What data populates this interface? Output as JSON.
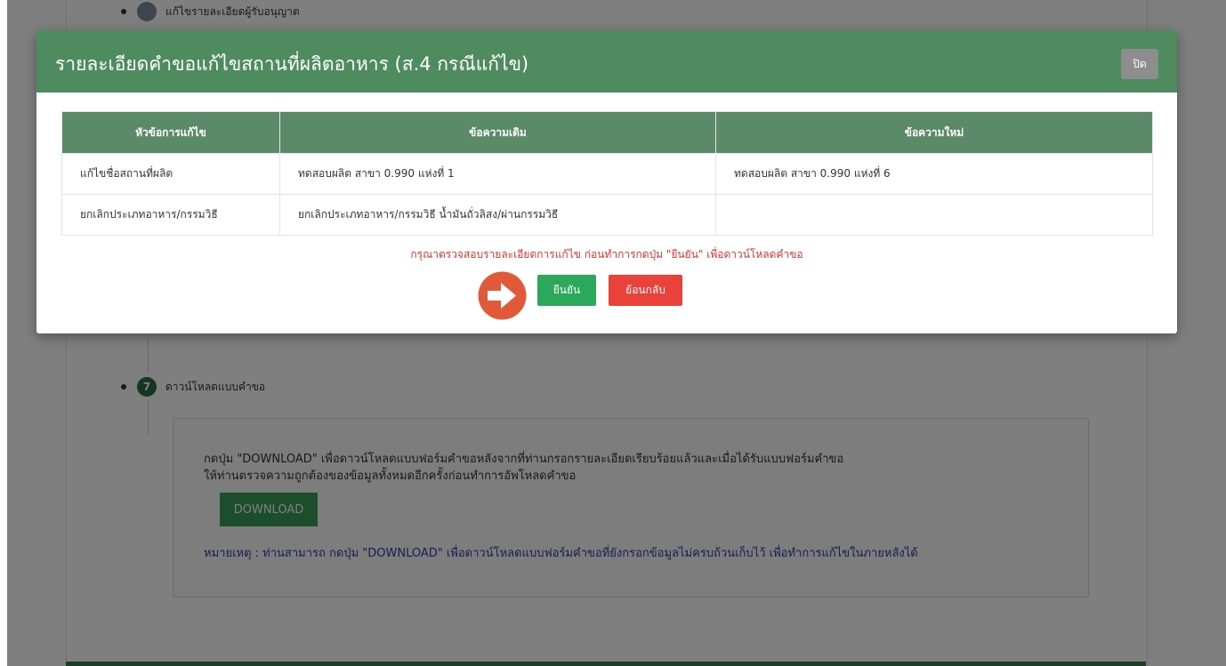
{
  "background": {
    "step_top": {
      "label": "แก้ไขรายละเอียดผู้รับอนุญาต"
    },
    "step_seven": {
      "number": "7",
      "label": "ดาวน์โหลดแบบคำขอ"
    },
    "download_section": {
      "instruction_line1": "กดปุ่ม \"DOWNLOAD\" เพื่อดาวน์โหลดแบบฟอร์มคำขอหลังจากที่ท่านกรอกรายละเอียดเรียบร้อยแล้วและเมื่อได้รับแบบฟอร์มคำขอ",
      "instruction_line2": "ให้ท่านตรวจความถูกต้องของข้อมูลทั้งหมดอีกครั้งก่อนทำการอัพโหลดคำขอ",
      "download_button": "DOWNLOAD",
      "note": "หมายเหตุ : ท่านสามารถ กดปุ่ม \"DOWNLOAD\" เพื่อดาวน์โหลดแบบฟอร์มคำขอที่ยังกรอกข้อมูลไม่ครบถ้วนเก็บไว้ เพื่อทำการแก้ไขในภายหลังได้"
    }
  },
  "modal": {
    "title": "รายละเอียดคำขอแก้ไขสถานที่ผลิตอาหาร (ส.4 กรณีแก้ไข)",
    "close_label": "ปิด",
    "table": {
      "headers": [
        "หัวข้อการแก้ไข",
        "ข้อความเดิม",
        "ข้อความใหม่"
      ],
      "rows": [
        [
          "แก้ไขชื่อสถานที่ผลิต",
          "ทดสอบผลิต สาขา 0.990 แห่งที่ 1",
          "ทดสอบผลิต สาขา 0.990 แห่งที่ 6"
        ],
        [
          "ยกเลิกประเภทอาหาร/กรรมวิธี",
          "ยกเลิกประเภทอาหาร/กรรมวิธี น้ำมันถั่วลิสง/ผ่านกรรมวิธี",
          ""
        ]
      ]
    },
    "warning": "กรุณาตรวจสอบรายละเอียดการแก้ไข ก่อนทำการกดปุ่ม \"ยืนยัน\" เพื่อดาวน์โหลดคำขอ",
    "confirm_label": "ยืนยัน",
    "back_label": "ย้อนกลับ",
    "arrow_icon": "arrow-right-circle-icon"
  },
  "colors": {
    "header": "#4e8b5f",
    "table_header": "#5a8a68",
    "confirm": "#2ca85a",
    "back": "#e8423b",
    "arrow": "#e05a3a",
    "warning_text": "#e0332b",
    "note_text": "#2a3fa0"
  }
}
